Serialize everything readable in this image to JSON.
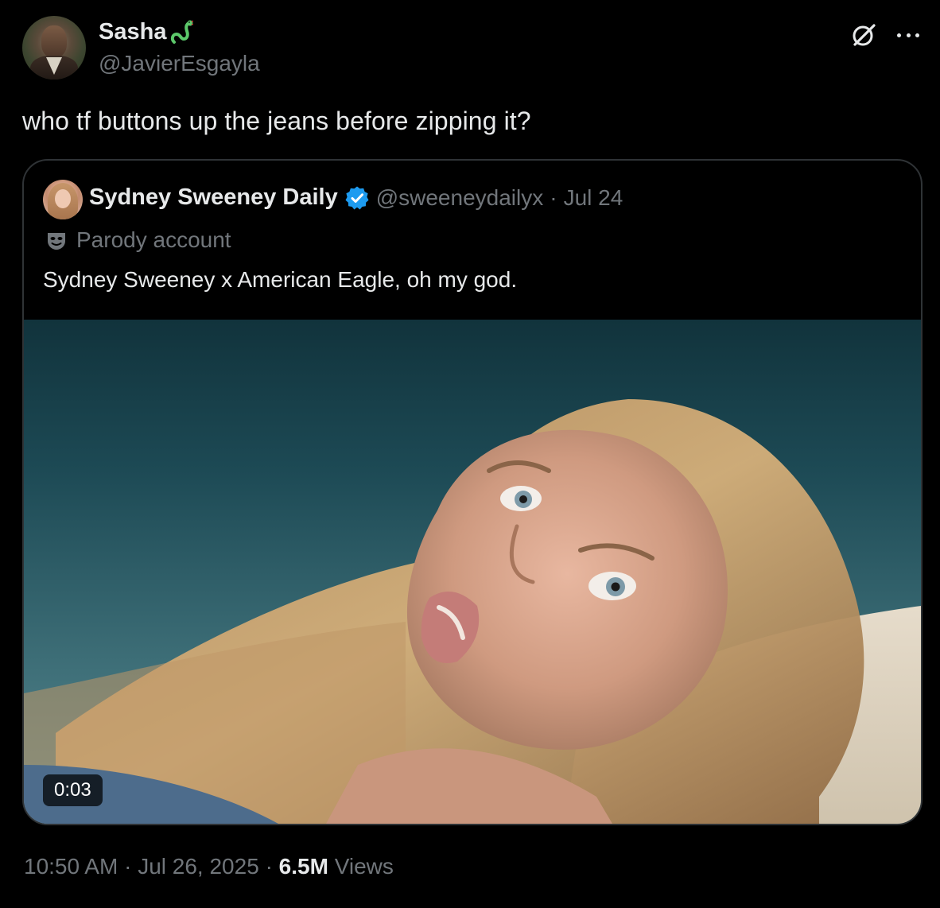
{
  "author": {
    "display_name": "Sasha",
    "name_emoji_icon": "snake-icon",
    "handle": "@JavierEsgayla"
  },
  "header_actions": {
    "grok_icon": "grok-icon",
    "more_icon": "more-icon"
  },
  "tweet": {
    "text": "who tf buttons up the jeans before zipping it?"
  },
  "quote": {
    "display_name": "Sydney Sweeney Daily",
    "verified_icon": "verified-badge-icon",
    "handle": "@sweeneydailyx",
    "separator": "·",
    "date": "Jul 24",
    "parody_icon": "mask-icon",
    "parody_label": "Parody account",
    "text": "Sydney Sweeney x American Eagle, oh my god.",
    "media": {
      "type": "video",
      "duration": "0:03"
    }
  },
  "meta": {
    "time": "10:50 AM",
    "separator": "·",
    "date": "Jul 26, 2025",
    "separator2": "·",
    "views_count": "6.5M",
    "views_label": "Views"
  },
  "colors": {
    "background": "#000000",
    "text_primary": "#e7e9ea",
    "text_secondary": "#71767b",
    "border": "#2f3336",
    "verified_blue": "#1d9bf0"
  }
}
